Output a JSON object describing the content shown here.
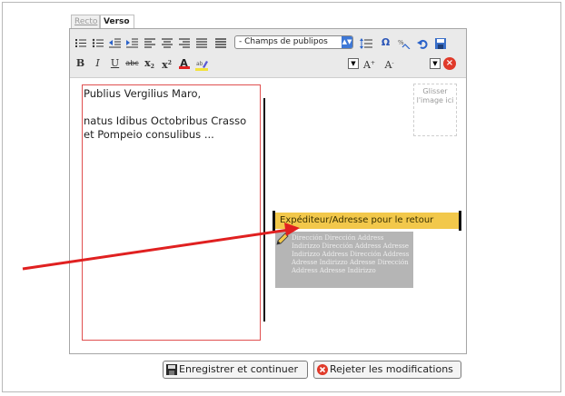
{
  "tabs": [
    {
      "label": "Recto",
      "active": false
    },
    {
      "label": "Verso",
      "active": true
    }
  ],
  "toolbar": {
    "fields_select": "- Champs de publipos",
    "font_color_label": "A",
    "grow_font_label": "A",
    "shrink_font_label": "A",
    "bold_label": "B",
    "italic_label": "I",
    "underline_label": "U",
    "strike_label": "abc",
    "subscript_label": "x",
    "superscript_label": "x",
    "omega_label": "Ω"
  },
  "message": {
    "line1": "Publius Vergilius Maro,",
    "line2": "natus Idibus Octobribus Crasso et Pompeio consulibus ..."
  },
  "stamp_placeholder": "Glisser l'image ici",
  "sender_label": "Expéditeur/Adresse pour le retour",
  "address_placeholder": "Dirección Dirección Address Indirizzo Dirección Address Adresse Indirizzo Address Dirección Address Adresse Indirizzo Adresse Dirección Address Adresse Indirizzo",
  "buttons": {
    "save": "Enregistrer et continuer",
    "reject": "Rejeter les modifications"
  },
  "colors": {
    "sender_bg": "#f2c84b",
    "arrow": "#e02020",
    "message_border": "#e05050",
    "select_arrow": "#3e78d6"
  }
}
